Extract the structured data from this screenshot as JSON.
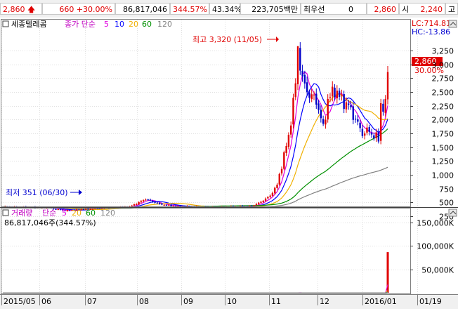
{
  "topbar": {
    "price": "2,860",
    "change": "660",
    "change_rate": "+30.00%",
    "volume": "86,817,046",
    "volume_rate": "344.57%",
    "turnover": "43.34%",
    "amount": "223,705백만",
    "uptick_label": "최우선",
    "uptick_value": "0",
    "price2": "2,860",
    "open_label": "시",
    "open_value": "2,240",
    "high_label": "고"
  },
  "price_panel": {
    "stock_name": "세종텔레콤",
    "ma_title": "종가 단순",
    "ma_periods": [
      "5",
      "10",
      "20",
      "60",
      "120"
    ],
    "ma_colors": [
      "#e000e0",
      "#0000ff",
      "#f0b000",
      "#009000",
      "#808080"
    ],
    "lc_label": "LC:714.81",
    "hc_label": "HC:-13.86",
    "current_price": "2,860",
    "current_rate": "30.00%",
    "high_annotation": "최고 3,320 (11/05)",
    "low_annotation": "최저 351 (06/30)",
    "y_ticks": [
      "3,250",
      "3,000",
      "2,750",
      "2,500",
      "2,250",
      "2,000",
      "1,750",
      "1,500",
      "1,250",
      "1,000",
      "750",
      "500",
      "250"
    ]
  },
  "volume_panel": {
    "title": "거래량",
    "ma_title": "단순",
    "ma_periods": [
      "5",
      "20",
      "60",
      "120"
    ],
    "current_volume": "86,817,046주(344.57%)",
    "y_ticks": [
      "150,000K",
      "100,000K",
      "50,000K"
    ]
  },
  "x_axis": [
    "2015/05",
    "06",
    "07",
    "08",
    "09",
    "10",
    "11",
    "12",
    "2016/01",
    "01/19"
  ],
  "colors": {
    "up": "#e00000",
    "down": "#0000c8",
    "grid": "#d8d8d8",
    "axis_bg": "#f0f0f0"
  },
  "chart_data": {
    "type": "candlestick",
    "title": "세종텔레콤",
    "ylim": [
      200,
      3400
    ],
    "high": {
      "value": 3320,
      "date": "11/05"
    },
    "low": {
      "value": 351,
      "date": "06/30"
    },
    "last_close": 2860,
    "volume_ylim": [
      0,
      180000
    ],
    "volume_unit": "K",
    "volume_last": 86817
  }
}
